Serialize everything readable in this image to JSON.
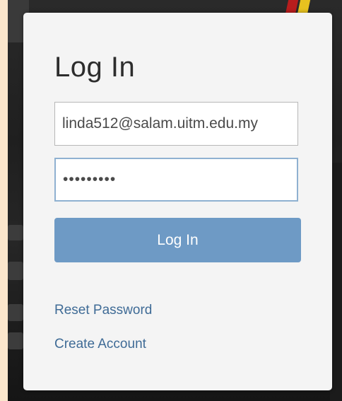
{
  "login": {
    "title": "Log In",
    "email_value": "linda512@salam.uitm.edu.my",
    "password_value": "•••••••••",
    "submit_label": "Log In",
    "reset_password_label": "Reset Password",
    "create_account_label": "Create Account"
  },
  "colors": {
    "accent": "#6e9ac5",
    "link": "#3f6b96",
    "modal_background": "#f4f4f4",
    "focus_border": "#8fb1d1"
  }
}
